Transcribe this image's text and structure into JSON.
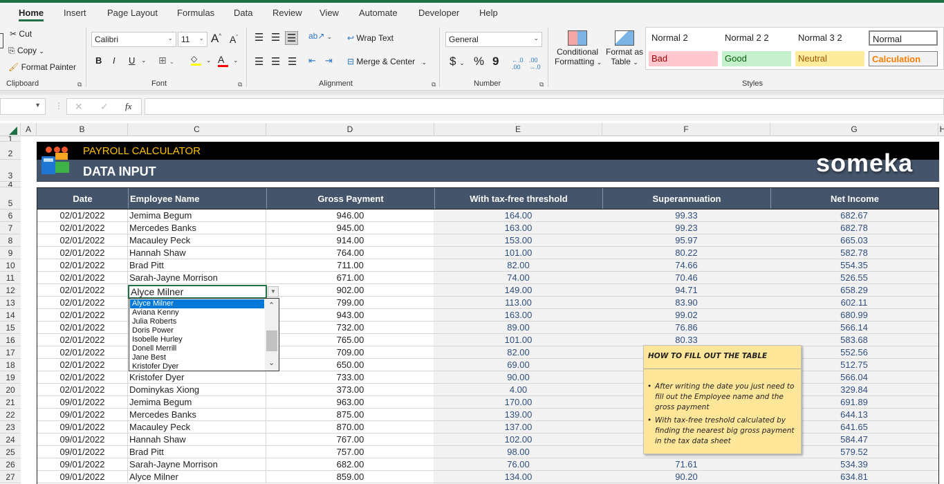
{
  "ribbon_tabs": [
    "Home",
    "Insert",
    "Page Layout",
    "Formulas",
    "Data",
    "Review",
    "View",
    "Automate",
    "Developer",
    "Help"
  ],
  "active_tab": "Home",
  "clipboard": {
    "cut": "Cut",
    "copy": "Copy",
    "format_painter": "Format Painter",
    "label": "Clipboard"
  },
  "font": {
    "name": "Calibri",
    "size": "11",
    "label": "Font",
    "bold": "B",
    "italic": "I",
    "underline": "U",
    "grow": "A",
    "shrink": "A",
    "fill_color": "#ffff00",
    "font_color": "#ff0000"
  },
  "alignment": {
    "wrap_text": "Wrap Text",
    "merge_center": "Merge & Center",
    "label": "Alignment"
  },
  "number": {
    "format": "General",
    "label": "Number",
    "currency": "$",
    "percent": "%",
    "comma": "9"
  },
  "cond_format": {
    "line1": "Conditional",
    "line2": "Formatting"
  },
  "format_table": {
    "line1": "Format as",
    "line2": "Table"
  },
  "styles": {
    "label": "Styles",
    "items": [
      {
        "name": "Normal 2",
        "bg": "#ffffff",
        "color": "#222222"
      },
      {
        "name": "Normal 2 2",
        "bg": "#ffffff",
        "color": "#222222"
      },
      {
        "name": "Normal 3 2",
        "bg": "#ffffff",
        "color": "#222222"
      },
      {
        "name": "Normal",
        "bg": "#ffffff",
        "color": "#222222"
      },
      {
        "name": "Bad",
        "bg": "#ffc7ce",
        "color": "#9c0006"
      },
      {
        "name": "Good",
        "bg": "#c6efce",
        "color": "#006100"
      },
      {
        "name": "Neutral",
        "bg": "#ffeb9c",
        "color": "#9c5700"
      },
      {
        "name": "Calculation",
        "bg": "#f2f2f2",
        "color": "#fa7d00"
      }
    ]
  },
  "formula_bar": {
    "name_box": "",
    "fx": "fx",
    "cancel": "✕",
    "enter": "✓",
    "formula": ""
  },
  "columns": [
    "A",
    "B",
    "C",
    "D",
    "E",
    "F",
    "G",
    "H"
  ],
  "row_numbers": [
    "1",
    "2",
    "3",
    "4",
    "5",
    "6",
    "7",
    "8",
    "9",
    "10",
    "11",
    "12",
    "13",
    "14",
    "15",
    "16",
    "17",
    "18",
    "19",
    "20",
    "21",
    "22",
    "23",
    "24",
    "25",
    "26",
    "27"
  ],
  "banner": {
    "title": "PAYROLL CALCULATOR",
    "subtitle": "DATA INPUT",
    "logo": "someka"
  },
  "table": {
    "headers": [
      "Date",
      "Employee Name",
      "Gross Payment",
      "With tax-free threshold",
      "Superannuation",
      "Net Income"
    ],
    "rows": [
      [
        "02/01/2022",
        "Jemima Begum",
        "946.00",
        "164.00",
        "99.33",
        "682.67"
      ],
      [
        "02/01/2022",
        "Mercedes Banks",
        "945.00",
        "163.00",
        "99.23",
        "682.78"
      ],
      [
        "02/01/2022",
        "Macauley Peck",
        "914.00",
        "153.00",
        "95.97",
        "665.03"
      ],
      [
        "02/01/2022",
        "Hannah Shaw",
        "764.00",
        "101.00",
        "80.22",
        "582.78"
      ],
      [
        "02/01/2022",
        "Brad Pitt",
        "711.00",
        "82.00",
        "74.66",
        "554.35"
      ],
      [
        "02/01/2022",
        "Sarah-Jayne Morrison",
        "671.00",
        "74.00",
        "70.46",
        "526.55"
      ],
      [
        "02/01/2022",
        "Alyce Milner",
        "902.00",
        "149.00",
        "94.71",
        "658.29"
      ],
      [
        "02/01/2022",
        "",
        "799.00",
        "113.00",
        "83.90",
        "602.11"
      ],
      [
        "02/01/2022",
        "",
        "943.00",
        "163.00",
        "99.02",
        "680.99"
      ],
      [
        "02/01/2022",
        "",
        "732.00",
        "89.00",
        "76.86",
        "566.14"
      ],
      [
        "02/01/2022",
        "",
        "765.00",
        "101.00",
        "80.33",
        "583.68"
      ],
      [
        "02/01/2022",
        "",
        "709.00",
        "82.00",
        "",
        "552.56"
      ],
      [
        "02/01/2022",
        "",
        "650.00",
        "69.00",
        "",
        "512.75"
      ],
      [
        "02/01/2022",
        "Kristofer Dyer",
        "733.00",
        "90.00",
        "",
        "566.04"
      ],
      [
        "02/01/2022",
        "Dominykas Xiong",
        "373.00",
        "4.00",
        "",
        "329.84"
      ],
      [
        "09/01/2022",
        "Jemima Begum",
        "963.00",
        "170.00",
        "",
        "691.89"
      ],
      [
        "09/01/2022",
        "Mercedes Banks",
        "875.00",
        "139.00",
        "",
        "644.13"
      ],
      [
        "09/01/2022",
        "Macauley Peck",
        "870.00",
        "137.00",
        "",
        "641.65"
      ],
      [
        "09/01/2022",
        "Hannah Shaw",
        "767.00",
        "102.00",
        "",
        "584.47"
      ],
      [
        "09/01/2022",
        "Brad Pitt",
        "757.00",
        "98.00",
        "",
        "579.52"
      ],
      [
        "09/01/2022",
        "Sarah-Jayne Morrison",
        "682.00",
        "76.00",
        "71.61",
        "534.39"
      ],
      [
        "09/01/2022",
        "Alyce Milner",
        "859.00",
        "134.00",
        "90.20",
        "634.81"
      ]
    ]
  },
  "dropdown": {
    "current": "Alyce Milner",
    "options": [
      "Alyce Milner",
      "Aviana Kenny",
      "Julia Roberts",
      "Doris Power",
      "Isobelle Hurley",
      "Donell Merrill",
      "Jane Best",
      "Kristofer Dyer"
    ],
    "selected_index": 0
  },
  "note": {
    "title": "HOW TO FILL OUT THE TABLE",
    "bullets": [
      "After writing the date you just need to fill out the Employee name and the gross payment",
      "With tax-free treshold calculated by finding the nearest big gross payment in the tax data sheet"
    ]
  }
}
